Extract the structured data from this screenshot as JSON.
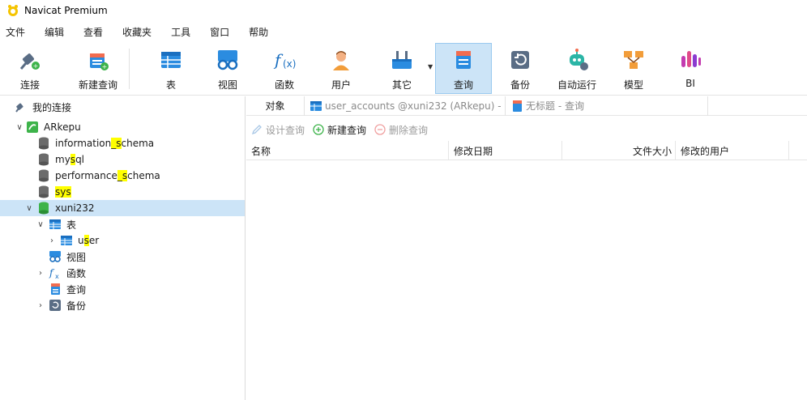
{
  "window": {
    "title": "Navicat Premium"
  },
  "menu": [
    "文件",
    "编辑",
    "查看",
    "收藏夹",
    "工具",
    "窗口",
    "帮助"
  ],
  "toolbar": {
    "connect": "连接",
    "new_query": "新建查询",
    "table": "表",
    "view": "视图",
    "function": "函数",
    "user": "用户",
    "other": "其它",
    "query": "查询",
    "backup": "备份",
    "automation": "自动运行",
    "model": "模型",
    "bi": "BI"
  },
  "sidebar": {
    "root": "我的连接",
    "connection": "ARkepu",
    "databases": [
      {
        "pre": "information",
        "hl": "_s",
        "post": "chema"
      },
      {
        "pre": "my",
        "hl": "s",
        "post": "ql"
      },
      {
        "pre": "performance",
        "hl": "_s",
        "post": "chema"
      },
      {
        "pre": "",
        "hl": "sys",
        "post": ""
      }
    ],
    "selected_db": "xuni232",
    "tables_label": "表",
    "table_user": {
      "pre": "u",
      "hl": "s",
      "post": "er"
    },
    "views_label": "视图",
    "functions_label": "函数",
    "queries_label": "查询",
    "backups_label": "备份"
  },
  "tabs": {
    "objects": "对象",
    "tab1": "user_accounts @xuni232 (ARkepu) - ...",
    "tab2": "无标题 - 查询"
  },
  "actions": {
    "design": "设计查询",
    "new": "新建查询",
    "delete": "删除查询"
  },
  "columns": {
    "name": "名称",
    "modified": "修改日期",
    "size": "文件大小",
    "modified_by": "修改的用户"
  },
  "colors": {
    "selection": "#cce4f7",
    "highlight": "#ffff00",
    "accent": "#1e90e0"
  }
}
